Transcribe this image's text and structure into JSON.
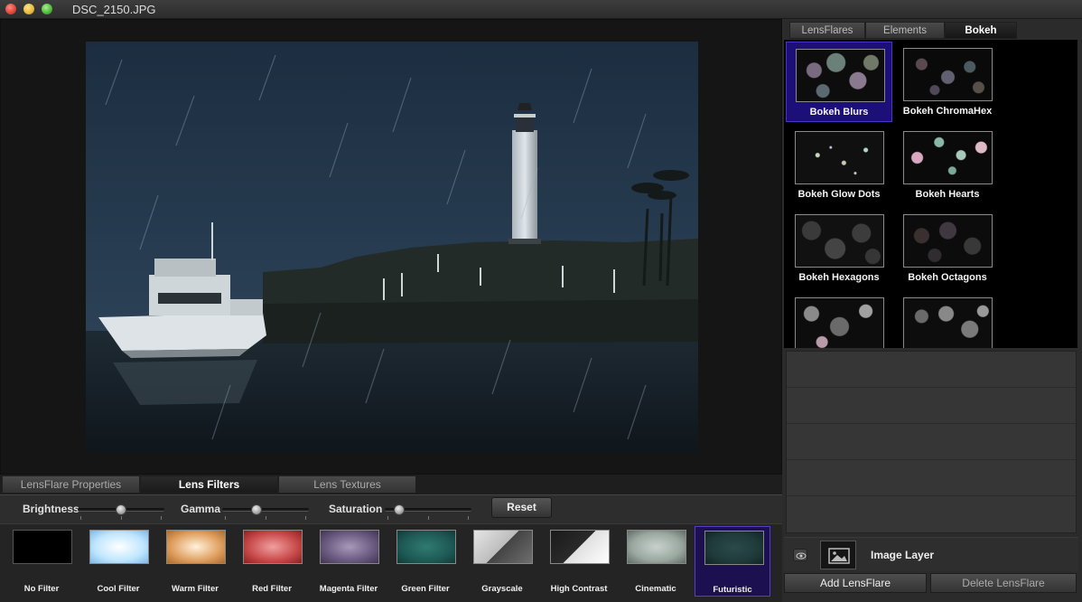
{
  "window": {
    "title": "DSC_2150.JPG"
  },
  "left_tabs": [
    "LensFlare Properties",
    "Lens Filters",
    "Lens Textures"
  ],
  "adjustments": {
    "brightness_label": "Brightness",
    "gamma_label": "Gamma",
    "saturation_label": "Saturation",
    "reset_label": "Reset"
  },
  "filters": [
    {
      "label": "No Filter",
      "color": "#000000"
    },
    {
      "label": "Cool Filter",
      "color": "#bfe6ff"
    },
    {
      "label": "Warm Filter",
      "color": "#e0a060"
    },
    {
      "label": "Red Filter",
      "color": "#c84a4a"
    },
    {
      "label": "Magenta Filter",
      "color": "#6a5a80"
    },
    {
      "label": "Green Filter",
      "color": "#1e5a55"
    },
    {
      "label": "Grayscale",
      "color": "#b0b0b0"
    },
    {
      "label": "High Contrast",
      "color": "#d0d0d0"
    },
    {
      "label": "Cinematic",
      "color": "#9aa8a0"
    },
    {
      "label": "Futuristic",
      "color": "#1f3a3a"
    }
  ],
  "selected_filter": "Futuristic",
  "right_tabs": [
    "LensFlares",
    "Elements",
    "Bokeh"
  ],
  "bokeh": [
    {
      "label": "Bokeh Blurs"
    },
    {
      "label": "Bokeh ChromaHex"
    },
    {
      "label": "Bokeh Glow Dots"
    },
    {
      "label": "Bokeh Hearts"
    },
    {
      "label": "Bokeh Hexagons"
    },
    {
      "label": "Bokeh Octagons"
    },
    {
      "label": ""
    },
    {
      "label": ""
    }
  ],
  "selected_bokeh": "Bokeh Blurs",
  "layer": {
    "name": "Image Layer"
  },
  "actions": {
    "add": "Add LensFlare",
    "delete": "Delete LensFlare"
  }
}
